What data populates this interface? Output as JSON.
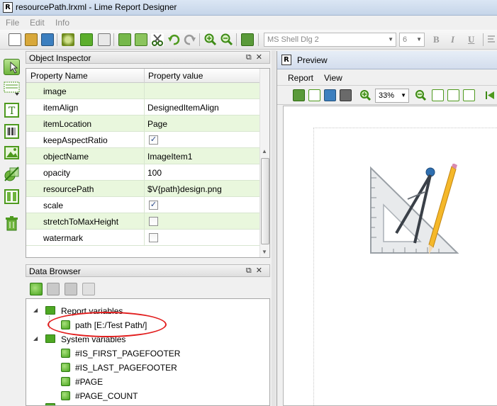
{
  "window": {
    "title": "resourcePath.lrxml - Lime Report Designer",
    "app_icon_letter": "R"
  },
  "menubar": {
    "items": [
      "File",
      "Edit",
      "Info"
    ]
  },
  "toolbar": {
    "font_name": "MS Shell Dlg 2",
    "font_size": "6",
    "bold_label": "B",
    "italic_label": "I",
    "underline_label": "U"
  },
  "object_inspector": {
    "title": "Object Inspector",
    "col_name": "Property Name",
    "col_value": "Property value",
    "rows": [
      {
        "name": "image",
        "value": "",
        "type": "text"
      },
      {
        "name": "itemAlign",
        "value": "DesignedItemAlign",
        "type": "text"
      },
      {
        "name": "itemLocation",
        "value": "Page",
        "type": "text"
      },
      {
        "name": "keepAspectRatio",
        "value": "true",
        "type": "checkbox"
      },
      {
        "name": "objectName",
        "value": "ImageItem1",
        "type": "text"
      },
      {
        "name": "opacity",
        "value": "100",
        "type": "text"
      },
      {
        "name": "resourcePath",
        "value": "$V{path}design.png",
        "type": "text"
      },
      {
        "name": "scale",
        "value": "true",
        "type": "checkbox"
      },
      {
        "name": "stretchToMaxHeight",
        "value": "false",
        "type": "checkbox"
      },
      {
        "name": "watermark",
        "value": "false",
        "type": "checkbox"
      }
    ]
  },
  "data_browser": {
    "title": "Data Browser",
    "report_variables_label": "Report variables",
    "report_variable": "path  [E:/Test Path/]",
    "system_variables_label": "System variables",
    "system_variables": [
      "#IS_FIRST_PAGEFOOTER",
      "#IS_LAST_PAGEFOOTER",
      "#PAGE",
      "#PAGE_COUNT"
    ]
  },
  "preview": {
    "title": "Preview",
    "menu": [
      "Report",
      "View"
    ],
    "zoom": "33%"
  },
  "colors": {
    "accent_green": "#4ea823",
    "row_green": "#e9f7dd",
    "annotation_red": "#e21d1d"
  }
}
